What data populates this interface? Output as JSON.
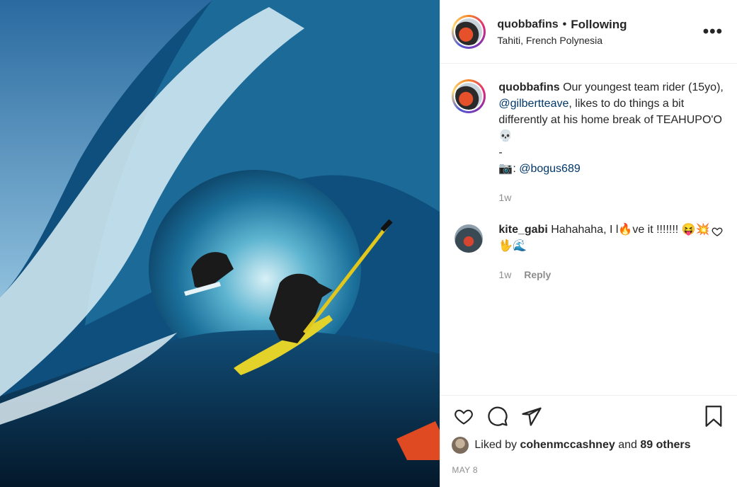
{
  "header": {
    "username": "quobbafins",
    "separator": "•",
    "follow_label": "Following",
    "location": "Tahiti, French Polynesia",
    "more_label": "•••"
  },
  "caption": {
    "username": "quobbafins",
    "text_before": "Our youngest team rider (15yo), ",
    "mention": "@gilbertteave",
    "text_after": ", likes to do things a bit differently at his home break of TEAHUPO'O 💀\n-\n📷: ",
    "photo_credit": "@bogus689",
    "time": "1w"
  },
  "comment": {
    "username": "kite_gabi",
    "text": "Hahahaha, I l🔥ve it !!!!!!! 😝💥🖖🌊",
    "time": "1w",
    "reply_label": "Reply"
  },
  "likes": {
    "prefix": "Liked by",
    "user": "cohenmccashney",
    "conjunction": "and",
    "others": "89 others"
  },
  "date": "MAY 8",
  "icons": {
    "like": "heart-icon",
    "comment": "comment-icon",
    "share": "share-icon",
    "save": "bookmark-icon",
    "comment_like": "heart-icon"
  }
}
